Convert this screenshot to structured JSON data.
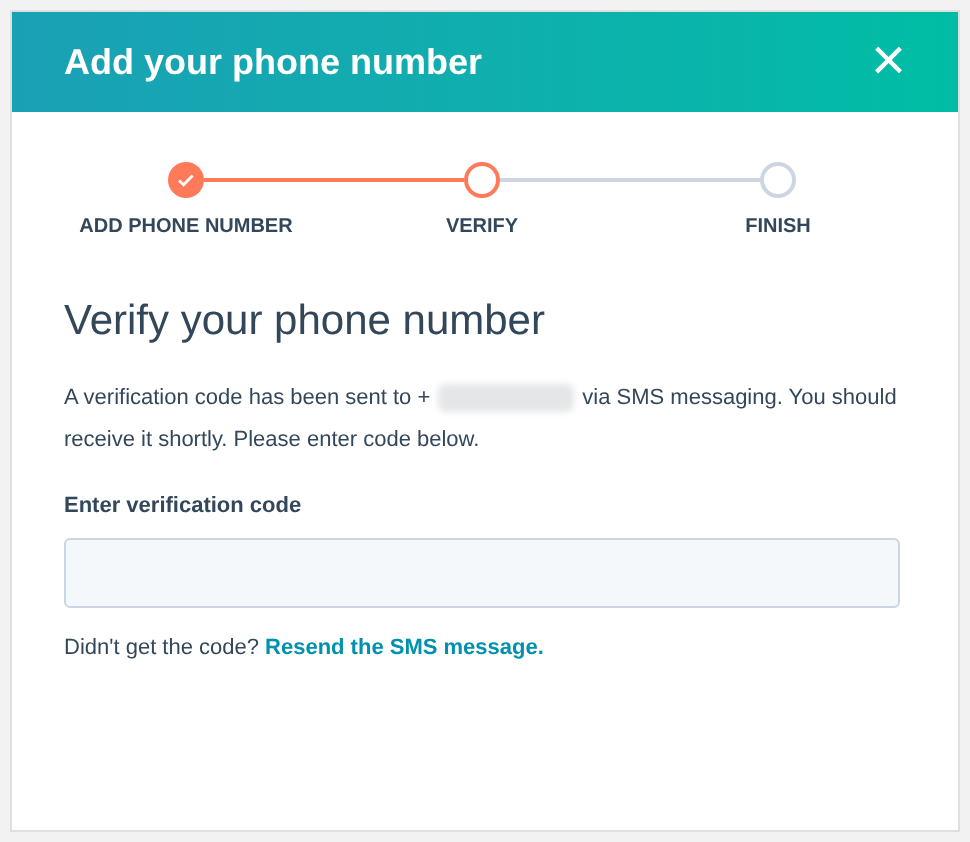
{
  "dialog": {
    "title": "Add your phone number",
    "close": "×"
  },
  "steps": [
    {
      "label": "ADD PHONE NUMBER",
      "kind": "done"
    },
    {
      "label": "VERIFY",
      "kind": "current"
    },
    {
      "label": "FINISH",
      "kind": "upcoming"
    }
  ],
  "heading": "Verify your phone number",
  "message": {
    "before": "A verification code has been sent to +",
    "after": "via SMS messaging. You should",
    "continued": "receive it shortly. Please enter code below."
  },
  "code_field": {
    "label": "Enter verification code"
  },
  "resend": {
    "prompt": "Didn't get the code?",
    "link": "Resend the SMS message."
  }
}
